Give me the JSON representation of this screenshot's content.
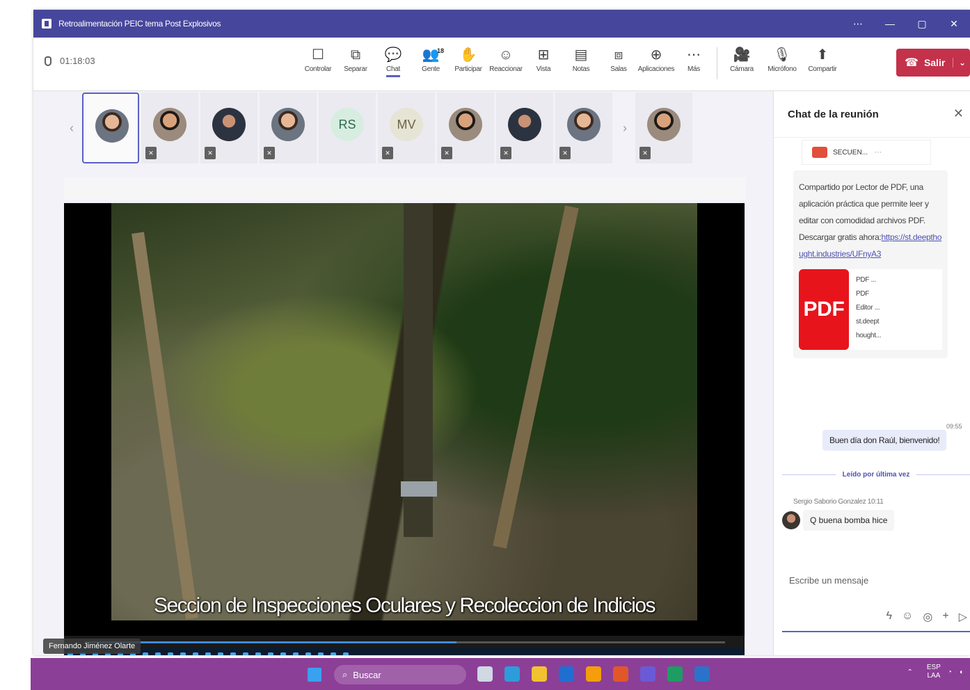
{
  "window": {
    "title": "Retroalimentación PEIC tema Post Explosivos",
    "controls": [
      "⋯",
      "—",
      "▢",
      "✕"
    ]
  },
  "meeting": {
    "timer": "01:18:03",
    "toolbar": [
      {
        "label": "Controlar",
        "icon": "control-icon",
        "glyph": "☐"
      },
      {
        "label": "Separar",
        "icon": "popout-icon",
        "glyph": "⧉"
      },
      {
        "label": "Chat",
        "icon": "chat-icon",
        "glyph": "💬",
        "active": true
      },
      {
        "label": "Gente",
        "icon": "people-icon",
        "glyph": "👥",
        "badge": "18"
      },
      {
        "label": "Participar",
        "icon": "raise-hand-icon",
        "glyph": "✋"
      },
      {
        "label": "Reaccionar",
        "icon": "react-icon",
        "glyph": "☺"
      },
      {
        "label": "Vista",
        "icon": "view-icon",
        "glyph": "⊞"
      },
      {
        "label": "Notas",
        "icon": "notes-icon",
        "glyph": "▤"
      },
      {
        "label": "Salas",
        "icon": "rooms-icon",
        "glyph": "⧈"
      },
      {
        "label": "Aplicaciones",
        "icon": "apps-icon",
        "glyph": "⊕"
      },
      {
        "label": "Más",
        "icon": "more-icon",
        "glyph": "⋯"
      }
    ],
    "media": [
      {
        "label": "Cámara",
        "icon": "camera-off-icon",
        "glyph": "🎥"
      },
      {
        "label": "Micrófono",
        "icon": "mic-off-icon",
        "glyph": "🎙"
      },
      {
        "label": "Compartir",
        "icon": "share-icon",
        "glyph": "⬆"
      }
    ],
    "leave_label": "Salir"
  },
  "participants": [
    {
      "type": "photo",
      "style": "photo",
      "selected": true,
      "muted": false
    },
    {
      "type": "photo",
      "style": "photo2",
      "muted": true
    },
    {
      "type": "photo",
      "style": "photo3",
      "muted": true
    },
    {
      "type": "photo",
      "style": "photo",
      "muted": true
    },
    {
      "type": "initials",
      "initials": "RS",
      "muted": false
    },
    {
      "type": "initials",
      "initials": "MV",
      "muted": true
    },
    {
      "type": "photo",
      "style": "photo2",
      "muted": true
    },
    {
      "type": "photo",
      "style": "photo3",
      "muted": true
    },
    {
      "type": "photo",
      "style": "photo",
      "muted": true
    },
    {
      "type": "photo",
      "style": "photo2",
      "muted": true
    }
  ],
  "presentation": {
    "subtitle": "Seccion de Inspecciones Oculares y Recoleccion de Indicios",
    "progress": 0.58,
    "presenter": "Fernando Jiménez Olarte"
  },
  "chat": {
    "title": "Chat de la reunión",
    "card_name": "SECUEN...",
    "shared_text": "Compartido por Lector de PDF, una aplicación práctica que permite leer y editar con comodidad archivos PDF. Descargar gratis ahora:",
    "shared_link": "https://st.deepthought.industries/UFnyA3",
    "pdf_label": "PDF",
    "pdf_meta": [
      "PDF ...",
      "PDF",
      "Editor ...",
      "st.deept",
      "hought..."
    ],
    "time": "09:55",
    "my_message": "Buen día don Raúl, bienvenido!",
    "seen_label": "Leído por última vez",
    "sender": "Sergio Saborio Gonzalez  10:11",
    "other_message": "Q buena bomba hice",
    "compose_placeholder": "Escribe un mensaje"
  },
  "taskbar": {
    "search_placeholder": "Buscar",
    "lang": [
      "ESP",
      "LAA"
    ],
    "app_colors": [
      "#cfd8e3",
      "#2d9cdb",
      "#f2c230",
      "#1f6fd1",
      "#f59e0b",
      "#e2572a",
      "#6b5ad6",
      "#1d9d63",
      "#2b73c8"
    ]
  }
}
